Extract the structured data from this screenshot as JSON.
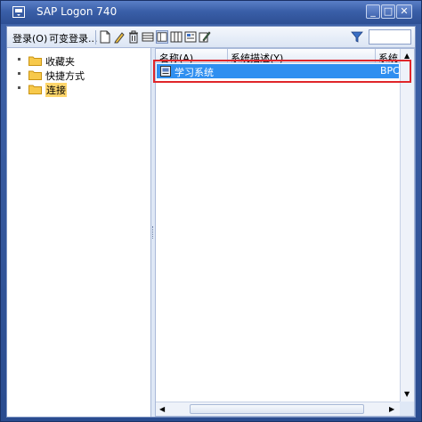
{
  "window": {
    "title": "SAP Logon 740",
    "minimize": "_",
    "maximize": "□",
    "close": "✕"
  },
  "toolbar": {
    "menu_logon": "登录(O)",
    "menu_variable_logon": "可变登录...",
    "icons": [
      "new-entry-icon",
      "edit-icon",
      "delete-icon",
      "list-view-icon",
      "explorer-view-icon",
      "grid-view-icon",
      "properties-icon",
      "edit-settings-icon",
      "filter-icon"
    ]
  },
  "tree": {
    "items": [
      {
        "label": "收藏夹",
        "selected": false
      },
      {
        "label": "快捷方式",
        "selected": false
      },
      {
        "label": "连接",
        "selected": true
      }
    ]
  },
  "list": {
    "columns": [
      "名称(A)",
      "系统描述(Y)",
      "系统..."
    ],
    "rows": [
      {
        "name": "学习系统",
        "system": "BPC",
        "selected": true
      }
    ]
  },
  "scroll": {
    "left": "◀",
    "right": "▶",
    "up": "▲",
    "down": "▼"
  },
  "colors": {
    "titlebar": "#3a5fa8",
    "selection": "#2f8ff0",
    "tree_selected": "#ffd66b",
    "highlight": "#e0262a"
  }
}
